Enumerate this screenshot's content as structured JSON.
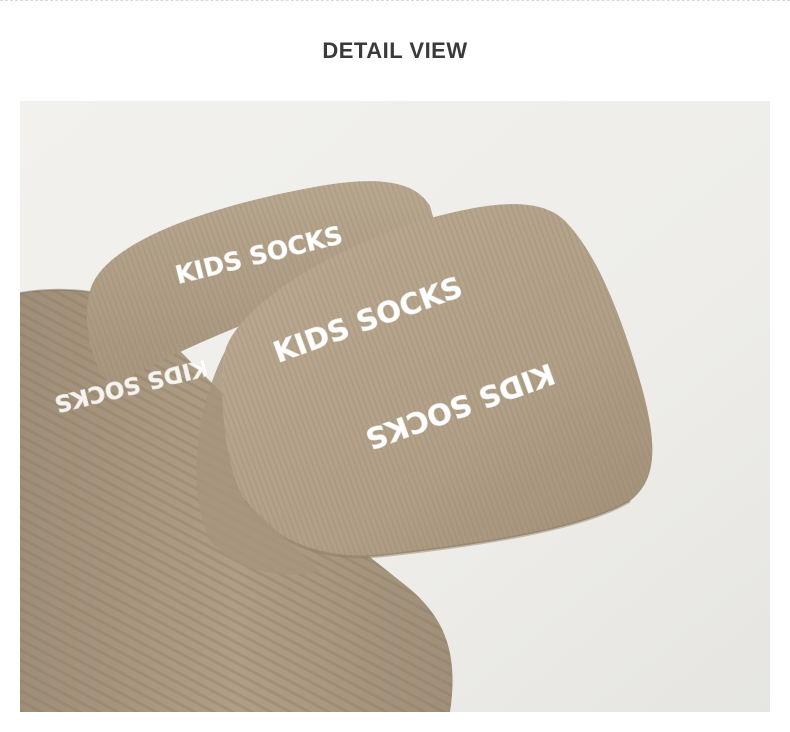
{
  "header": {
    "title": "DETAIL VIEW"
  },
  "photo": {
    "sole_prints": [
      "KIDS SOCKS",
      "KIDS SOCKS",
      "KIDS SOCKS",
      "KIDS SOCKS"
    ],
    "colors": {
      "background": "#f1f0ed",
      "sock": "#b4a38c",
      "sock_shadow": "#8e7e68",
      "print": "#ffffff"
    }
  }
}
